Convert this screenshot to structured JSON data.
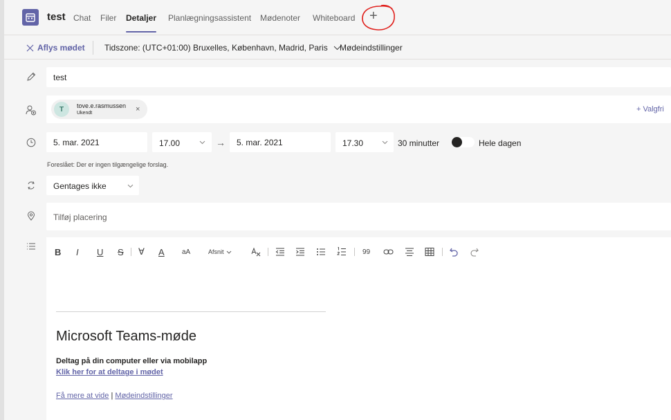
{
  "header": {
    "title": "test",
    "tabs": [
      {
        "label": "Chat"
      },
      {
        "label": "Filer"
      },
      {
        "label": "Detaljer"
      },
      {
        "label": "Planlægningsassistent"
      },
      {
        "label": "Mødenoter"
      },
      {
        "label": "Whiteboard"
      }
    ],
    "add_tab_label": "+"
  },
  "toolbar": {
    "cancel_label": "Aflys mødet",
    "timezone_label": "Tidszone: (UTC+01:00) Bruxelles, København, Madrid, Paris",
    "meeting_settings_label": "Mødeindstillinger"
  },
  "form": {
    "title_value": "test",
    "attendee": {
      "initial": "T",
      "name": "tove.e.rasmussen",
      "status": "Ukendt",
      "remove": "×"
    },
    "optional_label": "+ Valgfri",
    "start_date": "5. mar. 2021",
    "start_time": "17.00",
    "end_date": "5. mar. 2021",
    "end_time": "17.30",
    "duration": "30 minutter",
    "all_day_label": "Hele dagen",
    "all_day_on": false,
    "suggestion_text": "Foreslået: Der er ingen tilgængelige forslag.",
    "recurrence_value": "Gentages ikke",
    "location_placeholder": "Tilføj placering"
  },
  "editor": {
    "toolbar": {
      "bold": "B",
      "italic": "I",
      "underline": "U",
      "strike": "S",
      "highlight": "∀",
      "font_color": "A",
      "font_size": "aA",
      "paragraph_label": "Afsnit",
      "quote": "99"
    },
    "meeting_title": "Microsoft Teams-møde",
    "join_label": "Deltag på din computer eller via mobilapp",
    "join_link": "Klik her for at deltage i mødet",
    "learn_more": "Få mere at vide",
    "separator": "|",
    "settings_link": "Mødeindstillinger"
  },
  "colors": {
    "accent": "#6264a7",
    "annotation": "#e0201c"
  }
}
